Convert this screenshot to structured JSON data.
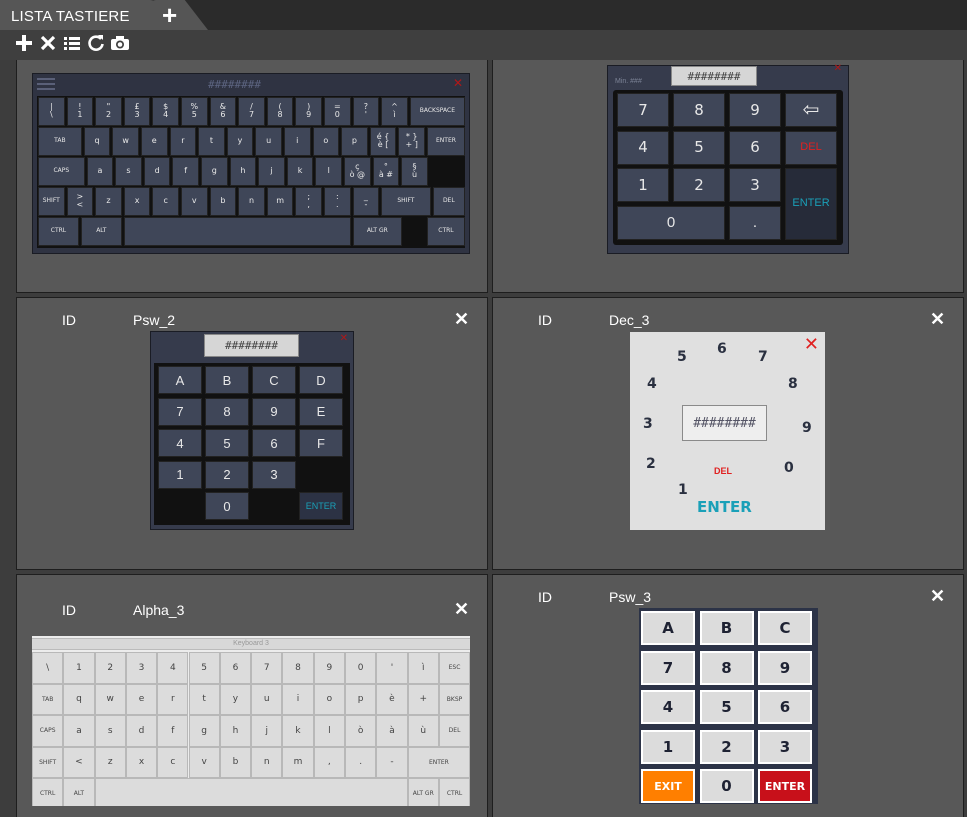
{
  "tab": {
    "label": "LISTA TASTIERE",
    "add": "+"
  },
  "toolbar": [
    "add",
    "delete",
    "list",
    "refresh",
    "camera"
  ],
  "cards": {
    "psw2": {
      "id_label": "ID",
      "id_value": "Psw_2"
    },
    "dec3": {
      "id_label": "ID",
      "id_value": "Dec_3"
    },
    "alpha3": {
      "id_label": "ID",
      "id_value": "Alpha_3"
    },
    "psw3": {
      "id_label": "ID",
      "id_value": "Psw_3"
    }
  },
  "kb1": {
    "display": "########",
    "rows": [
      [
        "|\n\\",
        "!\n1",
        "\"\n2",
        "£\n3",
        "$\n4",
        "%\n5",
        "&\n6",
        "/\n7",
        "(\n8",
        ")\n9",
        "=\n0",
        "?\n'",
        "^\nì",
        "BACKSPACE"
      ],
      [
        "TAB",
        "q",
        "w",
        "e",
        "r",
        "t",
        "y",
        "u",
        "i",
        "o",
        "p",
        "é {\nè [",
        "* }\n+ ]",
        "ENTER"
      ],
      [
        "CAPS",
        "a",
        "s",
        "d",
        "f",
        "g",
        "h",
        "j",
        "k",
        "l",
        "ç\nò @",
        "°\nà #",
        "§\nù"
      ],
      [
        "SHIFT",
        ">\n<",
        "z",
        "x",
        "c",
        "v",
        "b",
        "n",
        "m",
        ";\n,",
        ":\n.",
        "_\n-",
        "SHIFT",
        "DEL"
      ],
      [
        "CTRL",
        "ALT",
        "ALT GR",
        "CTRL"
      ]
    ]
  },
  "kb2": {
    "min": "Min. ###",
    "display": "########",
    "keys": [
      "7",
      "8",
      "9",
      "⇦",
      "4",
      "5",
      "6",
      "DEL",
      "1",
      "2",
      "3",
      "ENTER",
      "0",
      "."
    ]
  },
  "kb3": {
    "display": "########",
    "keys": [
      "A",
      "B",
      "C",
      "D",
      "7",
      "8",
      "9",
      "E",
      "4",
      "5",
      "6",
      "F",
      "1",
      "2",
      "3",
      "0",
      "ENTER"
    ]
  },
  "kb4": {
    "display": "########",
    "digits": [
      "5",
      "6",
      "7",
      "4",
      "8",
      "3",
      "9",
      "2",
      "0",
      "1"
    ],
    "del": "DEL",
    "enter": "ENTER"
  },
  "kb5": {
    "title": "Keyboard 3",
    "rows": [
      [
        "\\",
        "1",
        "2",
        "3",
        "4",
        "5",
        "6",
        "7",
        "8",
        "9",
        "0",
        "'",
        "ì",
        "ESC"
      ],
      [
        "TAB",
        "q",
        "w",
        "e",
        "r",
        "t",
        "y",
        "u",
        "i",
        "o",
        "p",
        "è",
        "+",
        "BKSP"
      ],
      [
        "CAPS",
        "a",
        "s",
        "d",
        "f",
        "g",
        "h",
        "j",
        "k",
        "l",
        "ò",
        "à",
        "ù",
        "DEL"
      ],
      [
        "SHIFT",
        "<",
        "z",
        "x",
        "c",
        "v",
        "b",
        "n",
        "m",
        ",",
        ".",
        "-",
        "ENTER"
      ],
      [
        "CTRL",
        "ALT",
        "ALT GR",
        "CTRL"
      ]
    ]
  },
  "kb6": {
    "keys": [
      "A",
      "B",
      "C",
      "7",
      "8",
      "9",
      "4",
      "5",
      "6",
      "1",
      "2",
      "3",
      "EXIT",
      "0",
      "ENTER"
    ]
  },
  "colors": {
    "background": "#3d3d3d",
    "card": "#585858",
    "key_dark": "#3f4658",
    "accent_red": "#e02020",
    "accent_cyan": "#1aa0b8",
    "exit_orange": "#ff7f00",
    "enter_red": "#c8101a"
  }
}
